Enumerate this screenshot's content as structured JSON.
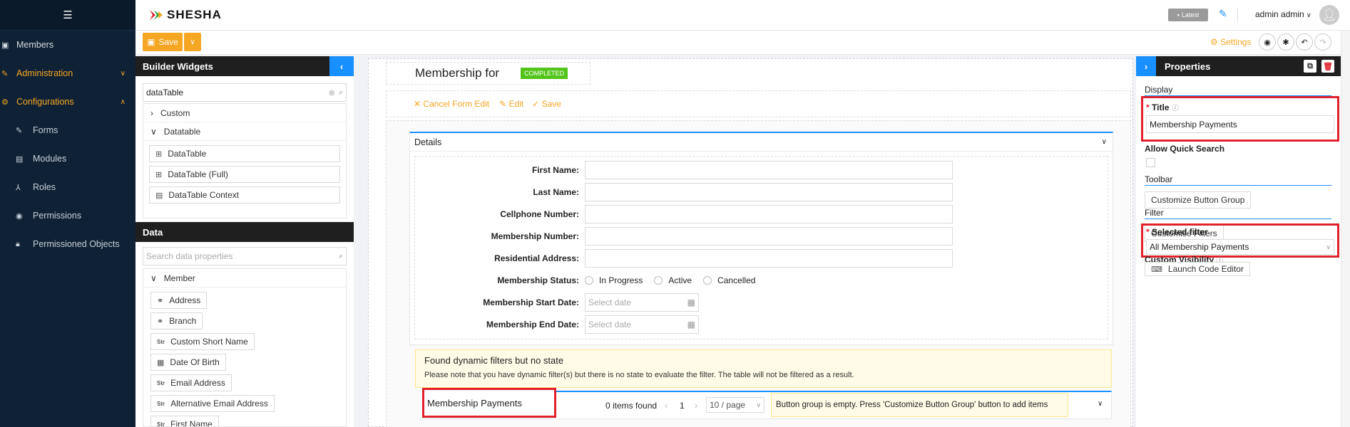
{
  "nav": {
    "members": "Members",
    "administration": "Administration",
    "configurations": "Configurations",
    "forms": "Forms",
    "modules": "Modules",
    "roles": "Roles",
    "permissions": "Permissions",
    "permissioned_objects": "Permissioned Objects"
  },
  "header": {
    "logo": "SHESHA",
    "latest": "Latest",
    "user": "admin admin"
  },
  "toolbar": {
    "save": "Save",
    "settings": "Settings"
  },
  "widgets": {
    "title": "Builder Widgets",
    "search_value": "dataTable",
    "groups": [
      "Custom",
      "Datatable"
    ],
    "items": [
      "DataTable",
      "DataTable (Full)",
      "DataTable Context"
    ]
  },
  "data_panel": {
    "title": "Data",
    "search_placeholder": "Search data properties",
    "group": "Member",
    "items": [
      {
        "type": "ref",
        "label": "Address"
      },
      {
        "type": "ref",
        "label": "Branch"
      },
      {
        "type": "str",
        "label": "Custom Short Name"
      },
      {
        "type": "date",
        "label": "Date Of Birth"
      },
      {
        "type": "str",
        "label": "Email Address"
      },
      {
        "type": "str",
        "label": "Alternative Email Address"
      },
      {
        "type": "str",
        "label": "First Name"
      }
    ],
    "str_tag": "Str"
  },
  "form": {
    "title": "Membership for",
    "status": "COMPLETED",
    "cancel_edit": "Cancel Form Edit",
    "edit": "Edit",
    "save": "Save",
    "details_title": "Details",
    "fields": [
      "First Name:",
      "Last Name:",
      "Cellphone Number:",
      "Membership Number:",
      "Residential Address:"
    ],
    "status_label": "Membership Status:",
    "status_options": [
      "In Progress",
      "Active",
      "Cancelled"
    ],
    "start_date_label": "Membership Start Date:",
    "end_date_label": "Membership End Date:",
    "date_placeholder": "Select date",
    "warning_title": "Found dynamic filters but no state",
    "warning_text": "Please note that you have dynamic filter(s) but there is no state to evaluate the filter. The table will not be filtered as a result.",
    "table_title": "Membership Payments",
    "items_found": "0 items found",
    "page": "1",
    "page_size": "10 / page",
    "empty_buttons": "Button group is empty. Press 'Customize Button Group' button to add items"
  },
  "properties": {
    "title": "Properties",
    "display": "Display",
    "title_label": "Title",
    "title_value": "Membership Payments",
    "allow_quick_search": "Allow Quick Search",
    "toolbar": "Toolbar",
    "customize_button_group": "Customize Button Group",
    "filter": "Filter",
    "customise_filters": "Customise Filters",
    "selected_filter_label": "Selected filter",
    "selected_filter_value": "All Membership Payments",
    "custom_visibility": "Custom Visibility",
    "launch_code_editor": "Launch Code Editor"
  },
  "colors": {
    "accent": "#f5a623",
    "nav_bg": "#0f2235",
    "link": "#1890ff",
    "highlight": "#e0212b",
    "status_green": "#52c41a"
  }
}
